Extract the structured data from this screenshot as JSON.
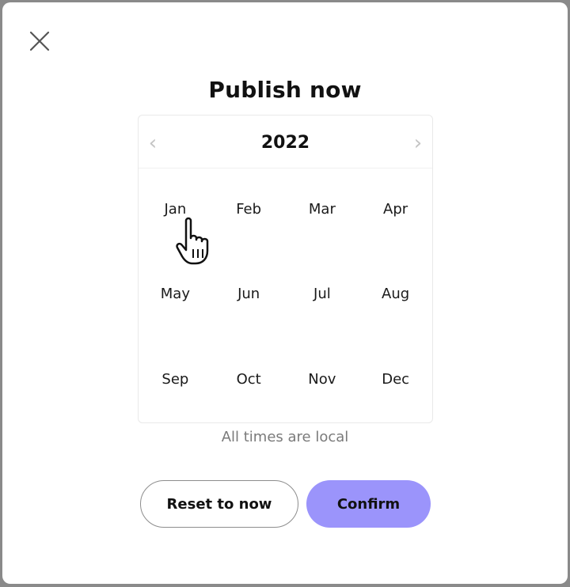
{
  "dialog": {
    "title": "Publish now",
    "close_icon": "close-icon"
  },
  "calendar": {
    "year": "2022",
    "prev_icon": "chevron-left-icon",
    "next_icon": "chevron-right-icon",
    "prev_glyph": "‹",
    "next_glyph": "›",
    "months": [
      "Jan",
      "Feb",
      "Mar",
      "Apr",
      "May",
      "Jun",
      "Jul",
      "Aug",
      "Sep",
      "Oct",
      "Nov",
      "Dec"
    ]
  },
  "note": "All times are local",
  "buttons": {
    "reset_label": "Reset to now",
    "confirm_label": "Confirm"
  },
  "colors": {
    "confirm_bg": "#9b94fb"
  }
}
